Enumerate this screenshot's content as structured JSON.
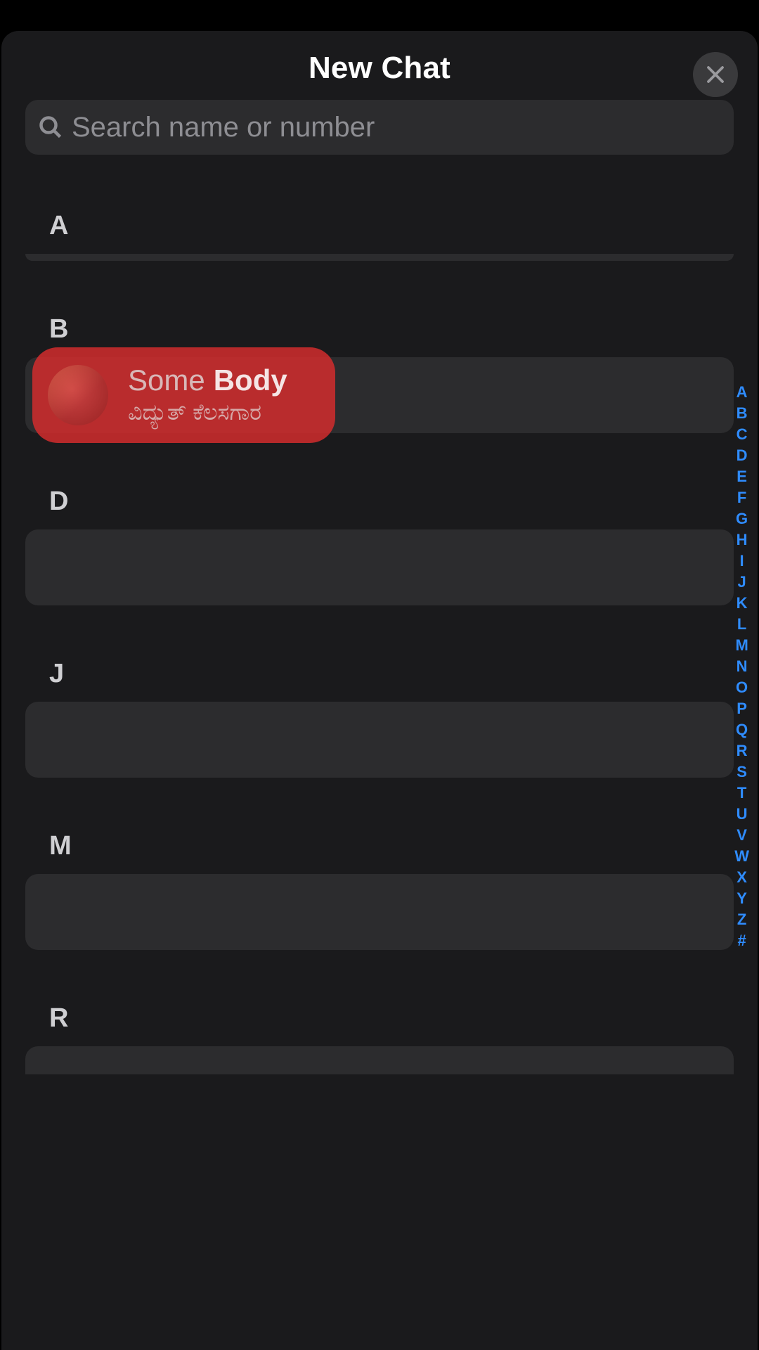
{
  "header": {
    "title": "New Chat"
  },
  "search": {
    "placeholder": "Search name or number"
  },
  "sections": [
    {
      "letter": "A"
    },
    {
      "letter": "B"
    },
    {
      "letter": "D"
    },
    {
      "letter": "J"
    },
    {
      "letter": "M"
    },
    {
      "letter": "R"
    }
  ],
  "highlighted_contact": {
    "first_name": "Some",
    "last_name": "Body",
    "subtitle": "ವಿದ್ಯುತ್ ಕೆಲಸಗಾರ"
  },
  "alpha_index": [
    "A",
    "B",
    "C",
    "D",
    "E",
    "F",
    "G",
    "H",
    "I",
    "J",
    "K",
    "L",
    "M",
    "N",
    "O",
    "P",
    "Q",
    "R",
    "S",
    "T",
    "U",
    "V",
    "W",
    "X",
    "Y",
    "Z",
    "#"
  ]
}
